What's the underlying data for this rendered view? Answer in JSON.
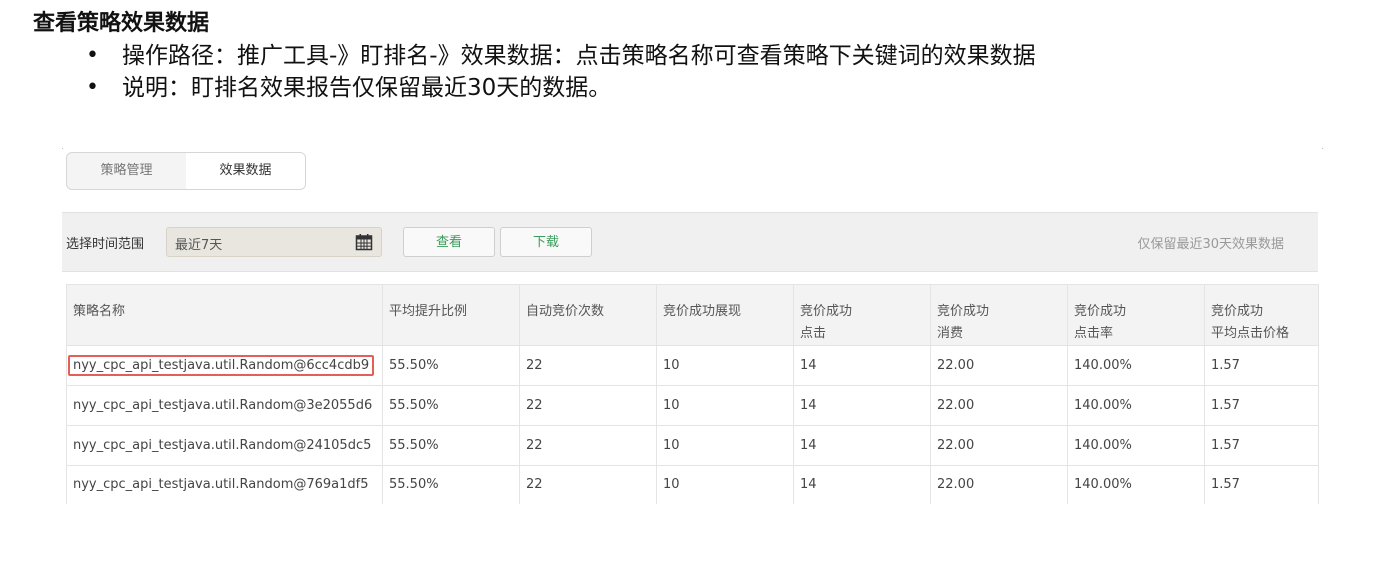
{
  "doc": {
    "title": "查看策略效果数据",
    "bullets": [
      "操作路径：推广工具-》盯排名-》效果数据：点击策略名称可查看策略下关键词的效果数据",
      "说明：盯排名效果报告仅保留最近30天的数据。"
    ]
  },
  "tabs": [
    {
      "label": "策略管理",
      "active": false
    },
    {
      "label": "效果数据",
      "active": true
    }
  ],
  "filter": {
    "label": "选择时间范围",
    "date_value": "最近7天",
    "calendar_icon": "calendar-icon",
    "view_button": "查看",
    "download_button": "下载",
    "note": "仅保留最近30天效果数据"
  },
  "table": {
    "headers": [
      [
        "策略名称"
      ],
      [
        "平均提升比例"
      ],
      [
        "自动竞价次数"
      ],
      [
        "竞价成功展现"
      ],
      [
        "竞价成功",
        "点击"
      ],
      [
        "竞价成功",
        "消费"
      ],
      [
        "竞价成功",
        "点击率"
      ],
      [
        "竞价成功",
        "平均点击价格"
      ]
    ],
    "rows": [
      [
        "nyy_cpc_api_testjava.util.Random@6cc4cdb9",
        "55.50%",
        "22",
        "10",
        "14",
        "22.00",
        "140.00%",
        "1.57"
      ],
      [
        "nyy_cpc_api_testjava.util.Random@3e2055d6",
        "55.50%",
        "22",
        "10",
        "14",
        "22.00",
        "140.00%",
        "1.57"
      ],
      [
        "nyy_cpc_api_testjava.util.Random@24105dc5",
        "55.50%",
        "22",
        "10",
        "14",
        "22.00",
        "140.00%",
        "1.57"
      ],
      [
        "nyy_cpc_api_testjava.util.Random@769a1df5",
        "55.50%",
        "22",
        "10",
        "14",
        "22.00",
        "140.00%",
        "1.57"
      ]
    ]
  },
  "colors": {
    "highlight_border": "#e3605a",
    "button_text": "#3a9c5a",
    "note_text": "#999999"
  }
}
